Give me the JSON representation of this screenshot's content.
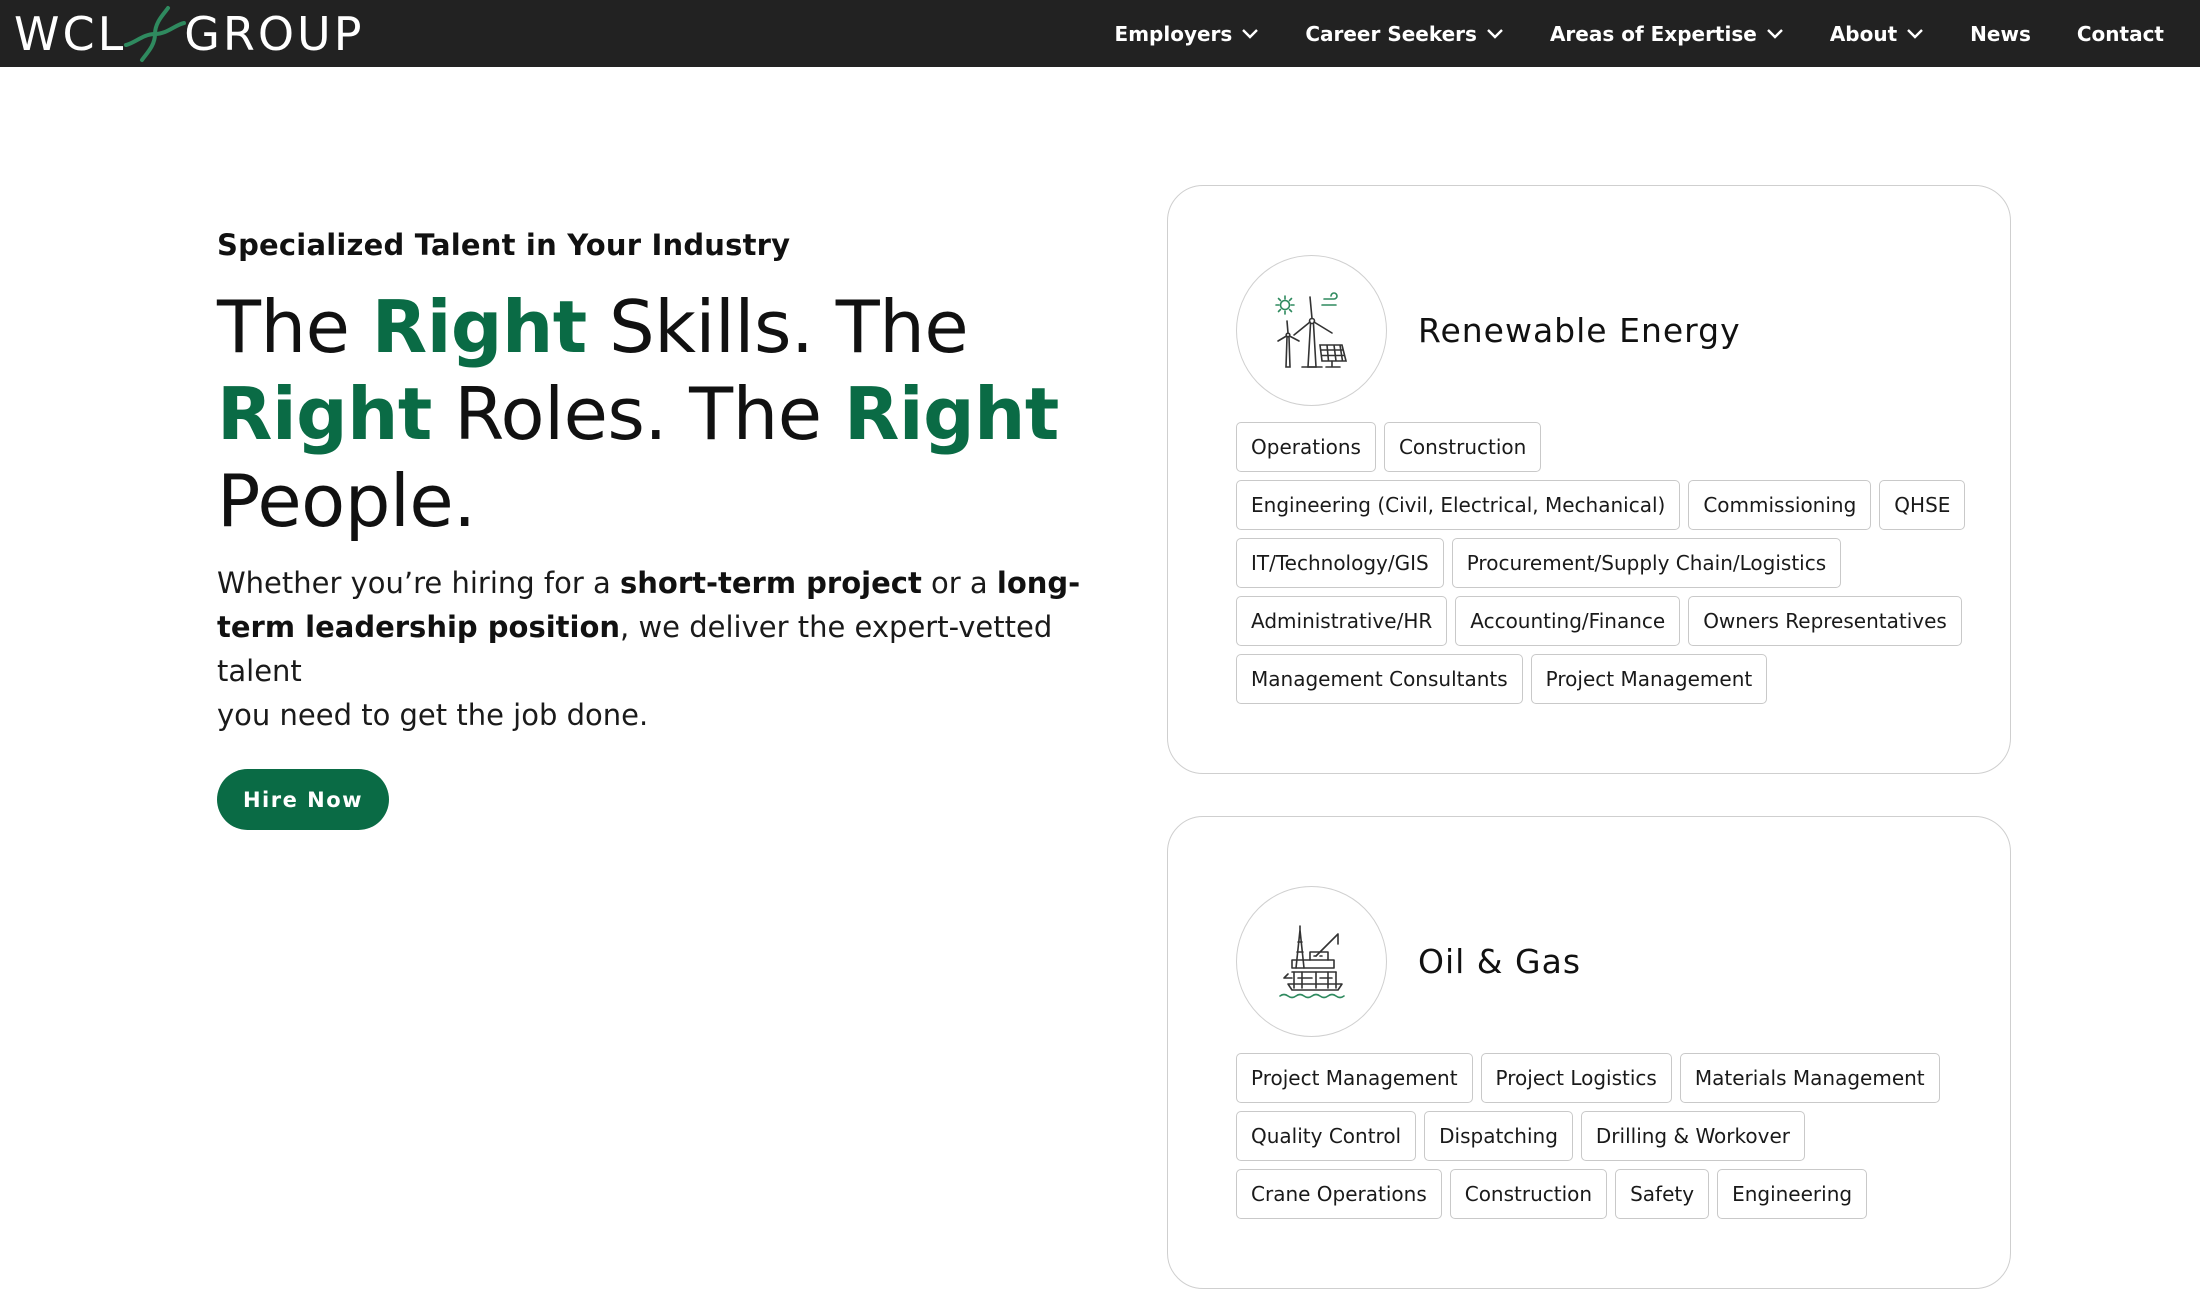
{
  "header": {
    "logo_left": "WCL",
    "logo_right": "GROUP",
    "nav": [
      {
        "label": "Employers",
        "has_dropdown": true
      },
      {
        "label": "Career Seekers",
        "has_dropdown": true
      },
      {
        "label": "Areas of Expertise",
        "has_dropdown": true
      },
      {
        "label": "About",
        "has_dropdown": true
      },
      {
        "label": "News",
        "has_dropdown": false
      },
      {
        "label": "Contact",
        "has_dropdown": false
      }
    ]
  },
  "hero": {
    "eyebrow": "Specialized Talent in Your Industry",
    "headline": {
      "p1": "The ",
      "g1": "Right",
      "p2": " Skills. The",
      "g2": "Right",
      "p3": " Roles. The ",
      "g3": "Right",
      "p4": "People."
    },
    "lede": {
      "t1": "Whether you’re hiring for a ",
      "b1": "short-term project",
      "t2": " or a ",
      "b2a": "long-",
      "b2b": "term leadership position",
      "t3": ", we deliver the expert-vetted talent",
      "t4": "you need to get the job done."
    },
    "cta_label": "Hire Now"
  },
  "cards": {
    "renewable": {
      "title": "Renewable Energy",
      "icon": "wind-solar-icon",
      "tags": [
        [
          "Operations",
          "Construction"
        ],
        [
          "Engineering (Civil, Electrical, Mechanical)",
          "Commissioning",
          "QHSE"
        ],
        [
          "IT/Technology/GIS",
          "Procurement/Supply Chain/Logistics"
        ],
        [
          "Administrative/HR",
          "Accounting/Finance",
          "Owners Representatives"
        ],
        [
          "Management Consultants",
          "Project Management"
        ]
      ]
    },
    "oilgas": {
      "title": "Oil & Gas",
      "icon": "oil-rig-icon",
      "tags": [
        [
          "Project Management",
          "Project Logistics",
          "Materials Management"
        ],
        [
          "Quality Control",
          "Dispatching",
          "Drilling & Workover"
        ],
        [
          "Crane Operations",
          "Construction",
          "Safety",
          "Engineering"
        ]
      ]
    }
  },
  "colors": {
    "brand_green": "#0a6b45",
    "header_bg": "#222222",
    "logo_accent": "#2f8a5f"
  }
}
